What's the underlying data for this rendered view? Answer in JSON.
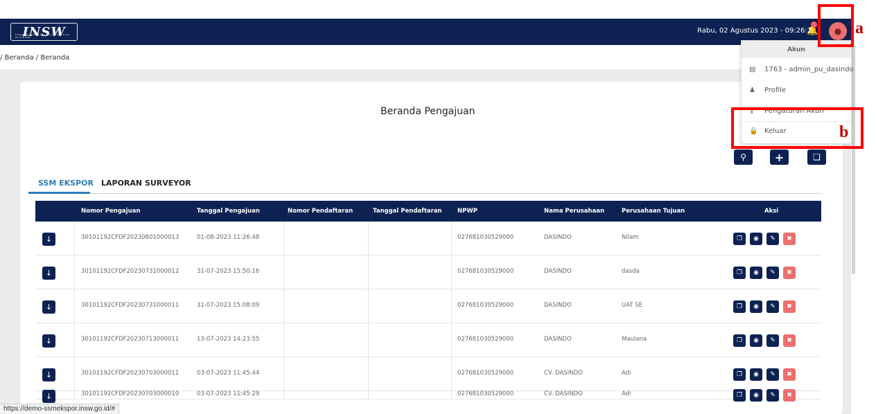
{
  "header": {
    "logo": "INSW",
    "logo_sub": "INDONESIA NATIONAL SINGLE WINDOW",
    "datetime": "Rabu, 02 Agustus 2023 - 09:26:29"
  },
  "breadcrumb": "/ Beranda / Beranda",
  "page_title": "Beranda Pengajuan",
  "tabs": [
    {
      "label": "SSM EKSPOR",
      "active": true
    },
    {
      "label": "LAPORAN SURVEYOR",
      "active": false
    }
  ],
  "table": {
    "headers": [
      "Nomor Pengajuan",
      "Tanggal Pengajuan",
      "Nomor Pendaftaran",
      "Tanggal Pendaftaran",
      "NPWP",
      "Nama Perusahaan",
      "Perusahaan Tujuan",
      "Aksi"
    ],
    "rows": [
      {
        "nomor": "30101192CFDF20230801000013",
        "tanggal": "01-08-2023 11:26:48",
        "no_daftar": "",
        "tgl_daftar": "",
        "npwp": "027681030529000",
        "nama": "DASINDO",
        "tujuan": "Nilam"
      },
      {
        "nomor": "30101192CFDF20230731000012",
        "tanggal": "31-07-2023 15:50:16",
        "no_daftar": "",
        "tgl_daftar": "",
        "npwp": "027681030529000",
        "nama": "DASINDO",
        "tujuan": "dasda"
      },
      {
        "nomor": "30101192CFDF20230731000011",
        "tanggal": "31-07-2023 15:08:09",
        "no_daftar": "",
        "tgl_daftar": "",
        "npwp": "027681030529000",
        "nama": "DASINDO",
        "tujuan": "UAT SE"
      },
      {
        "nomor": "30101192CFDF20230713000011",
        "tanggal": "13-07-2023 14:23:55",
        "no_daftar": "",
        "tgl_daftar": "",
        "npwp": "027681030529000",
        "nama": "DASINDO",
        "tujuan": "Maulana"
      },
      {
        "nomor": "30101192CFDF20230703000011",
        "tanggal": "03-07-2023 11:45:44",
        "no_daftar": "",
        "tgl_daftar": "",
        "npwp": "027681030529000",
        "nama": "CV. DASINDO",
        "tujuan": "Adi"
      },
      {
        "nomor": "30101192CFDF20230703000010",
        "tanggal": "03-07-2023 11:45:29",
        "no_daftar": "",
        "tgl_daftar": "",
        "npwp": "027681030529000",
        "nama": "CV. DASINDO",
        "tujuan": "Adi"
      }
    ]
  },
  "dropdown": {
    "header": "Akun",
    "items": [
      {
        "label": "1763 - admin_pu_dasindo",
        "icon": "id-card-icon"
      },
      {
        "label": "Profile",
        "icon": "user-icon"
      },
      {
        "label": "Pengaturan Akun",
        "icon": "key-icon"
      },
      {
        "label": "Keluar",
        "icon": "lock-icon"
      }
    ]
  },
  "annotations": {
    "a": "a",
    "b": "b"
  },
  "status_url": "https://demo-ssmekspor.insw.go.id/#",
  "colors": {
    "navy": "#0d2252",
    "red": "#ec6f6f",
    "accent": "#2f7db5",
    "annotation": "#ff0000"
  }
}
